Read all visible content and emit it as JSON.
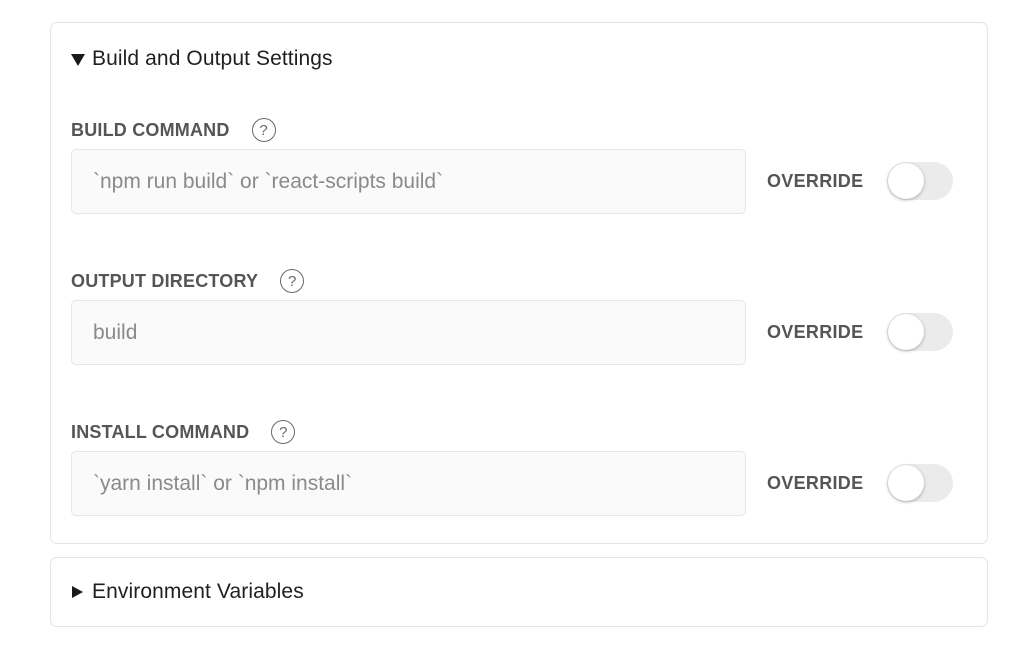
{
  "build_section": {
    "title": "Build and Output Settings",
    "expanded": true,
    "fields": [
      {
        "label": "BUILD COMMAND",
        "placeholder": "`npm run build` or `react-scripts build`",
        "value": "",
        "override_label": "OVERRIDE",
        "override_on": false
      },
      {
        "label": "OUTPUT DIRECTORY",
        "placeholder": "build",
        "value": "",
        "override_label": "OVERRIDE",
        "override_on": false
      },
      {
        "label": "INSTALL COMMAND",
        "placeholder": "`yarn install` or `npm install`",
        "value": "",
        "override_label": "OVERRIDE",
        "override_on": false
      }
    ]
  },
  "env_section": {
    "title": "Environment Variables",
    "expanded": false
  },
  "icons": {
    "help": "?",
    "expanded_caret": "triangle-down-icon",
    "collapsed_caret": "triangle-right-icon"
  },
  "colors": {
    "label_text": "#555555",
    "input_background": "#fafafa",
    "placeholder_text": "#8a8a8a",
    "toggle_off_track": "#ebebeb",
    "panel_border": "#e4e4e4"
  }
}
